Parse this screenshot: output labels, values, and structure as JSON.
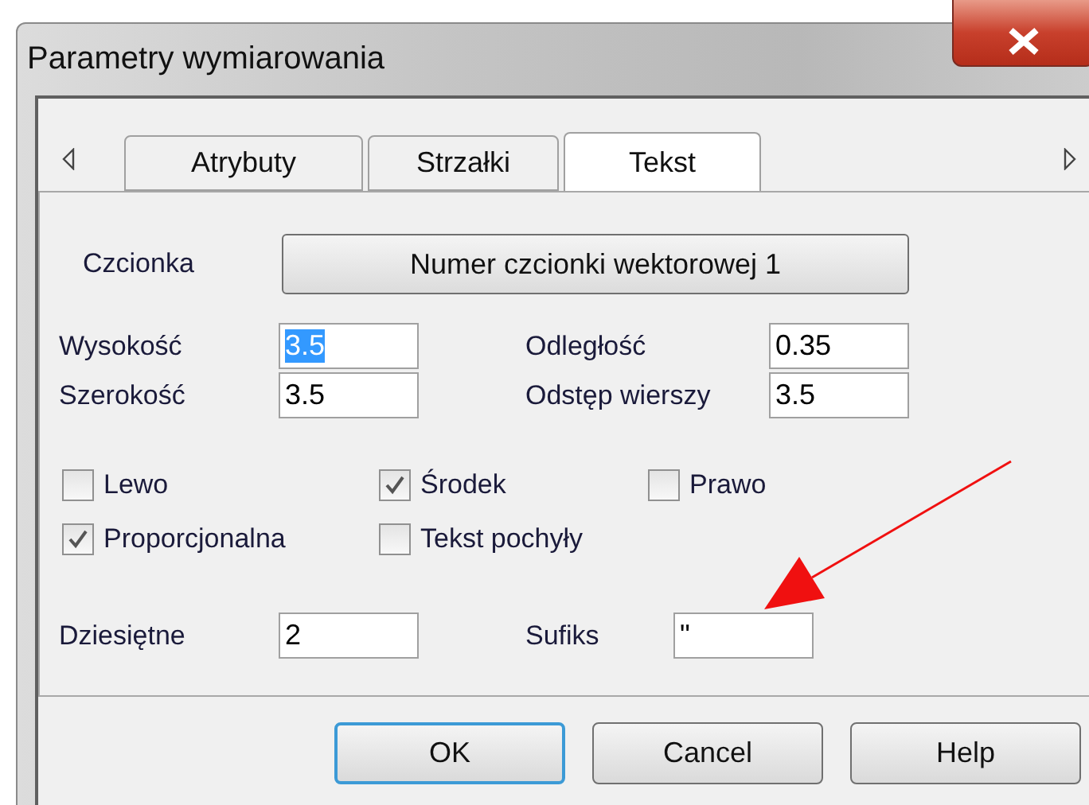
{
  "window": {
    "title": "Parametry wymiarowania"
  },
  "tabs": [
    {
      "label": "Atrybuty",
      "selected": false
    },
    {
      "label": "Strzałki",
      "selected": false
    },
    {
      "label": "Tekst",
      "selected": true
    }
  ],
  "font": {
    "label": "Czcionka",
    "button": "Numer czcionki wektorowej 1"
  },
  "fields": [
    {
      "label": "Wysokość",
      "value": "3.5",
      "highlighted": true
    },
    {
      "label": "Odległość",
      "value": "0.35",
      "highlighted": false
    },
    {
      "label": "Szerokość",
      "value": "3.5",
      "highlighted": false
    },
    {
      "label": "Odstęp wierszy",
      "value": "3.5",
      "highlighted": false
    }
  ],
  "checkboxes": [
    {
      "label": "Lewo",
      "checked": false
    },
    {
      "label": "Środek",
      "checked": true
    },
    {
      "label": "Prawo",
      "checked": false
    },
    {
      "label": "Proporcjonalna",
      "checked": true
    },
    {
      "label": "Tekst pochyły",
      "checked": false
    }
  ],
  "bottom_fields": [
    {
      "label": "Dziesiętne",
      "value": "2"
    },
    {
      "label": "Sufiks",
      "value": "\""
    }
  ],
  "buttons": [
    {
      "label": "OK",
      "default": true
    },
    {
      "label": "Cancel",
      "default": false
    },
    {
      "label": "Help",
      "default": false
    }
  ]
}
